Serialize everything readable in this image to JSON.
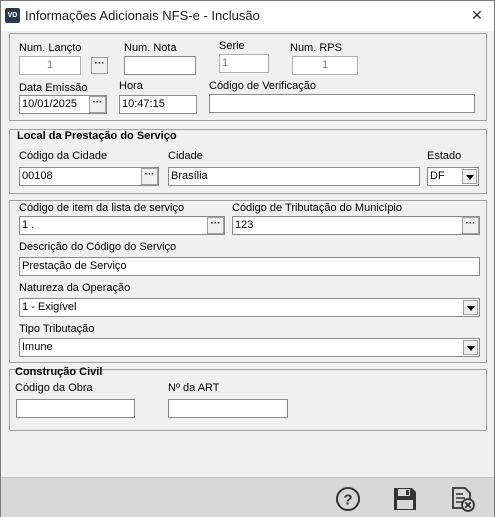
{
  "window": {
    "app_icon": "VD",
    "title": "Informações Adicionais NFS-e - Inclusão",
    "close": "✕"
  },
  "header": {
    "num_lancto": {
      "label": "Num. Lançto",
      "value": "1"
    },
    "num_nota": {
      "label": "Num. Nota",
      "value": ""
    },
    "serie": {
      "label": "Serie",
      "value": "1"
    },
    "num_rps": {
      "label": "Num. RPS",
      "value": "1"
    },
    "data_emissao": {
      "label": "Data Emissão",
      "value": "10/01/2025"
    },
    "hora": {
      "label": "Hora",
      "value": "10:47:15"
    },
    "codigo_verificacao": {
      "label": "Código de Verificação",
      "value": ""
    },
    "lookup_glyph": "···"
  },
  "local": {
    "section_title": "Local da Prestação do Serviço",
    "codigo_cidade": {
      "label": "Código da Cidade",
      "value": "00108"
    },
    "cidade": {
      "label": "Cidade",
      "value": "Brasília"
    },
    "estado": {
      "label": "Estado",
      "value": "DF"
    }
  },
  "servico": {
    "codigo_item": {
      "label": "Código de item da lista de serviço",
      "value": "1 ."
    },
    "codigo_tributacao": {
      "label": "Código de Tributação do Município",
      "value": "123"
    },
    "descricao": {
      "label": "Descrição do Código do Serviço",
      "value": "Prestação de Serviço"
    },
    "natureza": {
      "label": "Natureza da Operação",
      "value": "1 - Exigível"
    },
    "tipo_tributacao": {
      "label": "Tipo Tributação",
      "value": "Imune"
    }
  },
  "construcao": {
    "section_title": "Construção Civil",
    "codigo_obra": {
      "label": "Código da Obra",
      "value": ""
    },
    "numero_art": {
      "label": "Nº da ART",
      "value": ""
    }
  },
  "toolbar": {
    "help_icon": "question-circle-icon",
    "save_icon": "floppy-disk-icon",
    "cancel_icon": "document-cancel-icon",
    "help_glyph": "?"
  },
  "colors": {
    "window_bg": "#f0f0f0",
    "toolbar_bg": "#d8d8d8",
    "icon_dark": "#333333"
  }
}
